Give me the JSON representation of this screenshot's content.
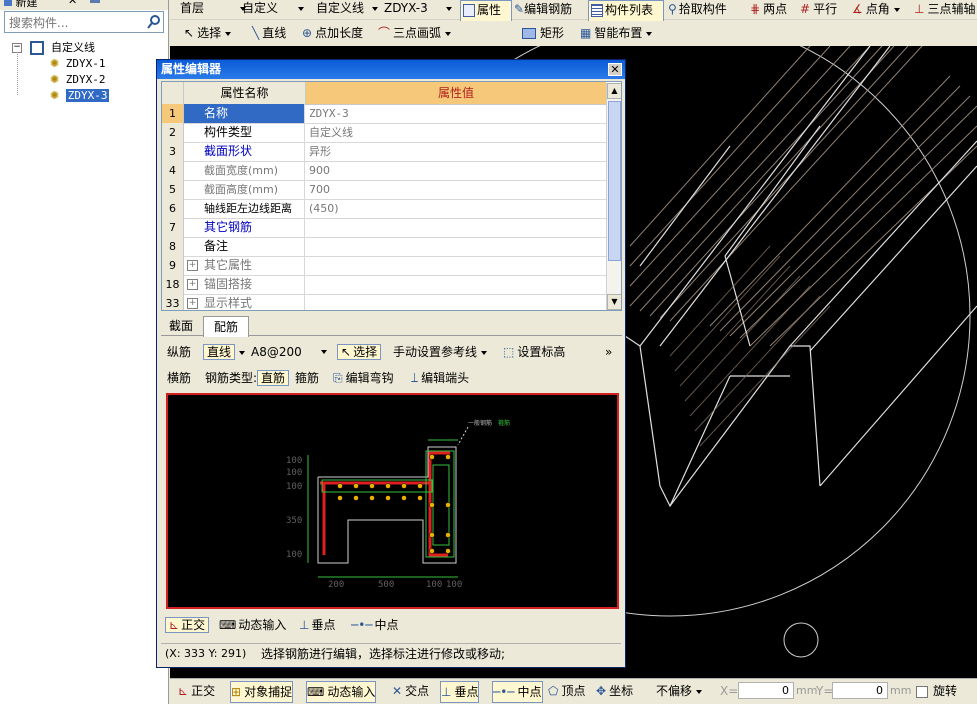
{
  "left_panel": {
    "toolbar": {
      "new_label": "新建"
    },
    "search": {
      "placeholder": "搜索构件..."
    },
    "tree": {
      "root": "自定义线",
      "items": [
        "ZDYX-1",
        "ZDYX-2",
        "ZDYX-3"
      ],
      "selected_index": 2
    }
  },
  "toolbar1": {
    "floor_combo": "首层",
    "category_combo": "自定义",
    "type_combo": "自定义线",
    "component_combo": "ZDYX-3",
    "properties_btn": "属性",
    "edit_rebar_btn": "编辑钢筋",
    "component_list_btn": "构件列表",
    "pick_component_btn": "拾取构件",
    "two_points_btn": "两点",
    "parallel_btn": "平行",
    "point_angle_btn": "点角",
    "three_point_aux_btn": "三点辅轴"
  },
  "toolbar2": {
    "select_btn": "选择",
    "line_btn": "直线",
    "point_length_btn": "点加长度",
    "three_point_arc_btn": "三点画弧",
    "rect_btn": "矩形",
    "smart_layout_btn": "智能布置"
  },
  "property_editor": {
    "title": "属性编辑器",
    "col_name": "属性名称",
    "col_value": "属性值",
    "rows": [
      {
        "num": "1",
        "name": "名称",
        "value": "ZDYX-3"
      },
      {
        "num": "2",
        "name": "构件类型",
        "value": "自定义线"
      },
      {
        "num": "3",
        "name": "截面形状",
        "value": "异形"
      },
      {
        "num": "4",
        "name": "截面宽度(mm)",
        "value": "900"
      },
      {
        "num": "5",
        "name": "截面高度(mm)",
        "value": "700"
      },
      {
        "num": "6",
        "name": "轴线距左边线距离",
        "value": "(450)"
      },
      {
        "num": "7",
        "name": "其它钢筋",
        "value": ""
      },
      {
        "num": "8",
        "name": "备注",
        "value": ""
      },
      {
        "num": "9",
        "name": "其它属性",
        "value": ""
      },
      {
        "num": "18",
        "name": "锚固搭接",
        "value": ""
      },
      {
        "num": "33",
        "name": "显示样式",
        "value": ""
      }
    ],
    "tabs": [
      "截面",
      "配筋"
    ],
    "active_tab": "配筋",
    "longitudinal_label": "纵筋",
    "straight_combo": "直线",
    "rebar_spec_combo": "A8@200",
    "select_btn": "选择",
    "manual_ref_combo": "手动设置参考线",
    "set_elevation_btn": "设置标高",
    "more_btn": "»",
    "transverse_label": "横筋",
    "rebar_type_label": "钢筋类型:",
    "straight_rebar_btn": "直筋",
    "stirrup_btn": "箍筋",
    "edit_hook_btn": "编辑弯钩",
    "edit_end_btn": "编辑端头",
    "snap_ortho": "正交",
    "snap_dynamic": "动态输入",
    "snap_perp": "垂点",
    "snap_mid": "中点",
    "status_coords": "(X: 333 Y: 291)",
    "status_msg": "选择钢筋进行编辑，选择标注进行修改或移动;",
    "section_dims": {
      "left_side": [
        "100",
        "100",
        "100",
        "350",
        "100"
      ],
      "bottom": [
        "200",
        "500",
        "100",
        "100"
      ],
      "labels": [
        "一般钢筋",
        "箍筋"
      ]
    }
  },
  "bottom_bar": {
    "ortho": "正交",
    "object_snap": "对象捕捉",
    "dynamic_input": "动态输入",
    "intersection": "交点",
    "perpendicular": "垂点",
    "midpoint": "中点",
    "vertex": "顶点",
    "coordinate": "坐标",
    "offset_combo": "不偏移",
    "x_label": "X=",
    "x_value": "0",
    "y_label": "Y=",
    "y_value": "0",
    "unit": "mm",
    "rotate": "旋转"
  }
}
